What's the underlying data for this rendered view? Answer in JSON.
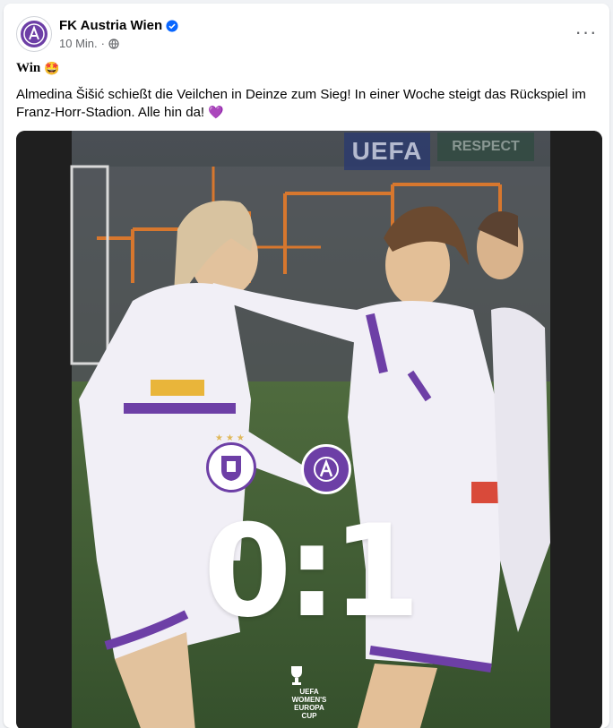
{
  "post": {
    "page_name": "FK Austria Wien",
    "time": "10 Min.",
    "separator": "·",
    "title": "Win",
    "title_emoji": "🤩",
    "body": "Almedina Šišić schießt die Veilchen in Deinze zum Sieg! In einer Woche steigt das Rückspiel im Franz-Horr-Stadion. Alle hin da!",
    "body_emoji": "💜",
    "more_label": "···"
  },
  "photo": {
    "score": "0:1",
    "banner_left": "UEFA",
    "banner_right": "RESPECT",
    "competition_logo_text": "UEFA WOMEN'S EUROPA CUP"
  },
  "icons": {
    "avatar": "club-crest-icon",
    "verified": "verified-badge-icon",
    "audience": "globe-icon",
    "more": "more-options-icon"
  },
  "colors": {
    "verified": "#0866ff",
    "club_purple": "#6d3fa6",
    "meta_text": "#65676b"
  }
}
